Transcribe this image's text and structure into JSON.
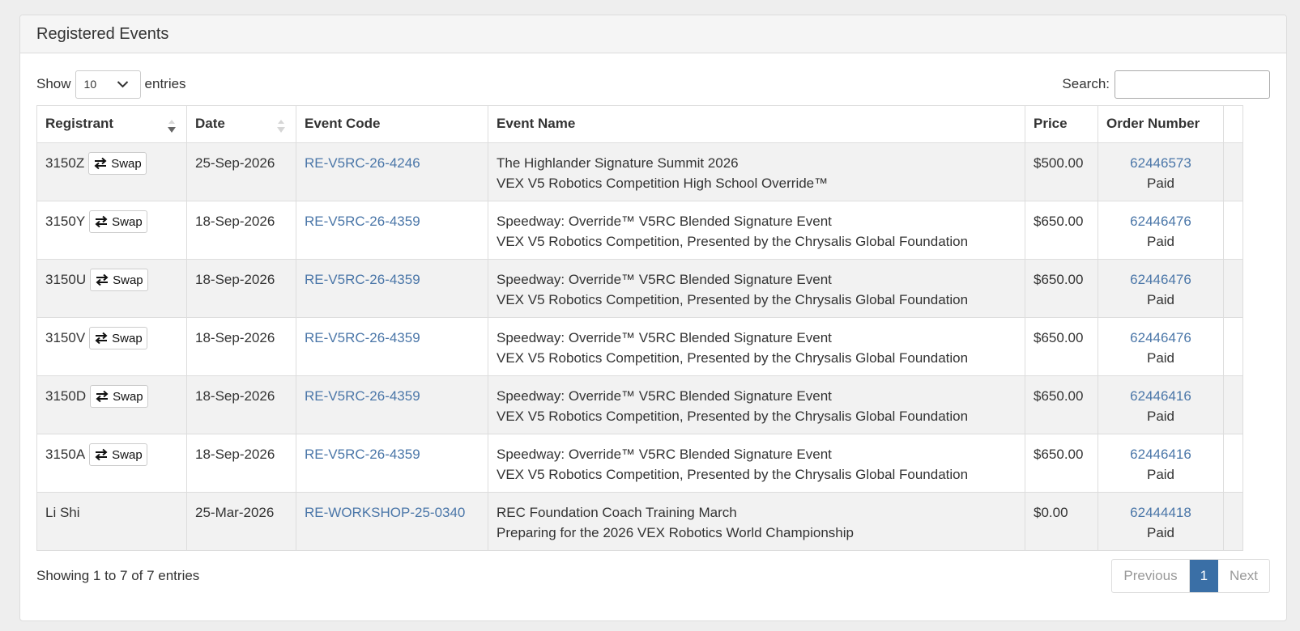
{
  "panel": {
    "title": "Registered Events"
  },
  "length": {
    "show": "Show",
    "value": "10",
    "entries": "entries"
  },
  "search": {
    "label": "Search:",
    "value": ""
  },
  "columns": {
    "registrant": "Registrant",
    "date": "Date",
    "code": "Event Code",
    "name": "Event Name",
    "price": "Price",
    "order": "Order Number"
  },
  "swap_label": "Swap",
  "rows": [
    {
      "registrant": "3150Z",
      "date": "25-Sep-2026",
      "code": "RE-V5RC-26-4246",
      "name1": "The Highlander Signature Summit 2026",
      "name2": "VEX V5 Robotics Competition High School Override™",
      "price": "$500.00",
      "order": "62446573",
      "status": "Paid"
    },
    {
      "registrant": "3150Y",
      "date": "18-Sep-2026",
      "code": "RE-V5RC-26-4359",
      "name1": "Speedway: Override™ V5RC Blended Signature Event",
      "name2": "VEX V5 Robotics Competition, Presented by the Chrysalis Global Foundation",
      "price": "$650.00",
      "order": "62446476",
      "status": "Paid"
    },
    {
      "registrant": "3150U",
      "date": "18-Sep-2026",
      "code": "RE-V5RC-26-4359",
      "name1": "Speedway: Override™ V5RC Blended Signature Event",
      "name2": "VEX V5 Robotics Competition, Presented by the Chrysalis Global Foundation",
      "price": "$650.00",
      "order": "62446476",
      "status": "Paid"
    },
    {
      "registrant": "3150V",
      "date": "18-Sep-2026",
      "code": "RE-V5RC-26-4359",
      "name1": "Speedway: Override™ V5RC Blended Signature Event",
      "name2": "VEX V5 Robotics Competition, Presented by the Chrysalis Global Foundation",
      "price": "$650.00",
      "order": "62446476",
      "status": "Paid"
    },
    {
      "registrant": "3150D",
      "date": "18-Sep-2026",
      "code": "RE-V5RC-26-4359",
      "name1": "Speedway: Override™ V5RC Blended Signature Event",
      "name2": "VEX V5 Robotics Competition, Presented by the Chrysalis Global Foundation",
      "price": "$650.00",
      "order": "62446416",
      "status": "Paid"
    },
    {
      "registrant": "3150A",
      "date": "18-Sep-2026",
      "code": "RE-V5RC-26-4359",
      "name1": "Speedway: Override™ V5RC Blended Signature Event",
      "name2": "VEX V5 Robotics Competition, Presented by the Chrysalis Global Foundation",
      "price": "$650.00",
      "order": "62446416",
      "status": "Paid"
    },
    {
      "registrant": "Li Shi",
      "date": "25-Mar-2026",
      "code": "RE-WORKSHOP-25-0340",
      "name1": "REC Foundation Coach Training March",
      "name2": "Preparing for the 2026 VEX Robotics World Championship",
      "price": "$0.00",
      "order": "62444418",
      "status": "Paid"
    }
  ],
  "footer": {
    "info": "Showing 1 to 7 of 7 entries",
    "previous": "Previous",
    "page": "1",
    "next": "Next"
  }
}
